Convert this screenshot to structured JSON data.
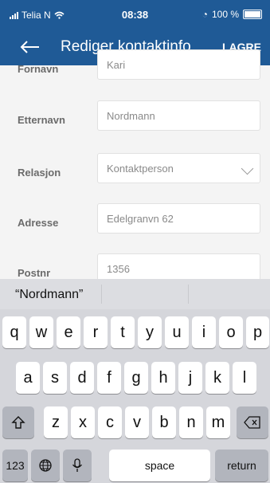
{
  "status_bar": {
    "carrier": "Telia N",
    "time": "08:38",
    "battery": "100 %"
  },
  "nav": {
    "title": "Rediger kontaktinfo",
    "save_label": "LAGRE"
  },
  "form": {
    "fields": [
      {
        "label": "Fornavn",
        "value": "Kari"
      },
      {
        "label": "Etternavn",
        "value": "Nordmann"
      },
      {
        "label": "Relasjon",
        "value": "Kontaktperson"
      },
      {
        "label": "Adresse",
        "value": "Edelgranvn 62"
      },
      {
        "label": "Postnr",
        "value": "1356"
      }
    ]
  },
  "keyboard": {
    "suggestion": "“Nordmann”",
    "row1": [
      "q",
      "w",
      "e",
      "r",
      "t",
      "y",
      "u",
      "i",
      "o",
      "p"
    ],
    "row2": [
      "a",
      "s",
      "d",
      "f",
      "g",
      "h",
      "j",
      "k",
      "l"
    ],
    "row3": [
      "z",
      "x",
      "c",
      "v",
      "b",
      "n",
      "m"
    ],
    "numbers": "123",
    "space": "space",
    "return": "return"
  },
  "icons": {
    "back": "back-arrow-icon",
    "signal": "cellular-signal-icon",
    "wifi": "wifi-icon",
    "alarm": "alarm-icon",
    "battery": "battery-icon",
    "shift": "shift-icon",
    "delete": "delete-icon",
    "globe": "globe-icon",
    "mic": "microphone-icon"
  }
}
